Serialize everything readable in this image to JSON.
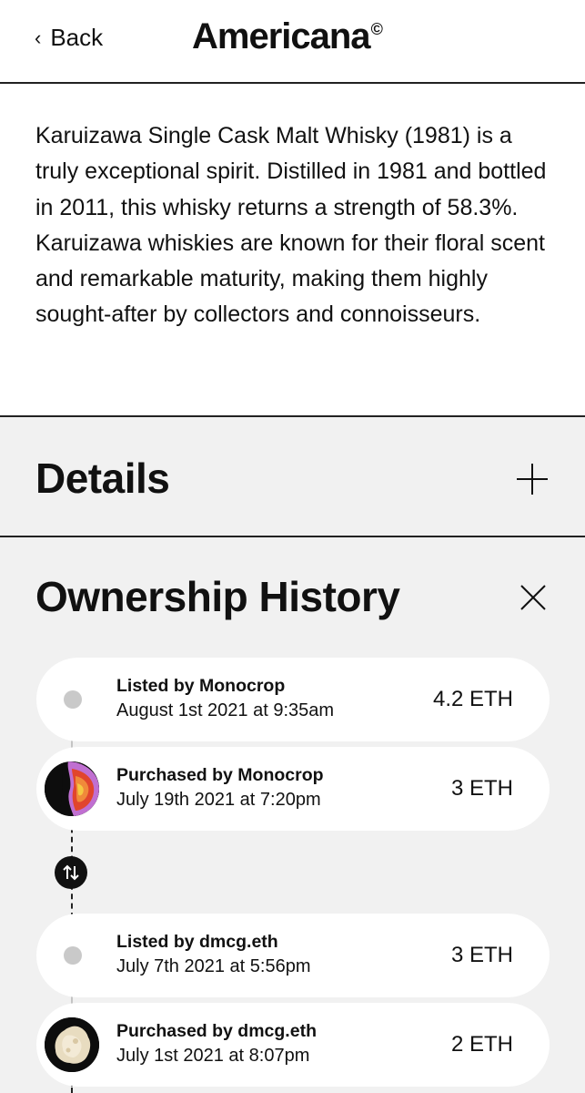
{
  "header": {
    "back_label": "Back",
    "brand_name": "Americana",
    "brand_mark": "©"
  },
  "description": {
    "text": "Karuizawa Single Cask Malt Whisky (1981) is a truly exceptional spirit. Distilled in 1981 and bottled in 2011, this whisky returns a strength of 58.3%. Karuizawa whiskies are known for their floral scent and remarkable maturity, making them highly sought-after by collectors and connoisseurs."
  },
  "details": {
    "title": "Details",
    "expand_icon": "plus-icon"
  },
  "ownership_history": {
    "title": "Ownership History",
    "close_icon": "close-icon",
    "events": [
      {
        "title": "Listed by Monocrop",
        "date": "August 1st 2021 at 9:35am",
        "price": "4.2 ETH",
        "icon": "timeline-dot"
      },
      {
        "title": "Purchased by Monocrop",
        "date": "July 19th 2021 at 7:20pm",
        "price": "3 ETH",
        "icon": "monocrop-avatar"
      },
      {
        "title": "Listed by dmcg.eth",
        "date": "July 7th 2021 at 5:56pm",
        "price": "3 ETH",
        "icon": "timeline-dot"
      },
      {
        "title": "Purchased by dmcg.eth",
        "date": "July 1st 2021 at 8:07pm",
        "price": "2 ETH",
        "icon": "dmcg-avatar"
      }
    ],
    "transfer_icon": "swap-arrows-icon"
  },
  "colors": {
    "background": "#f1f1f1",
    "card": "#ffffff",
    "text": "#111111",
    "divider": "#222222",
    "timeline_dot": "#c9c9c9"
  }
}
